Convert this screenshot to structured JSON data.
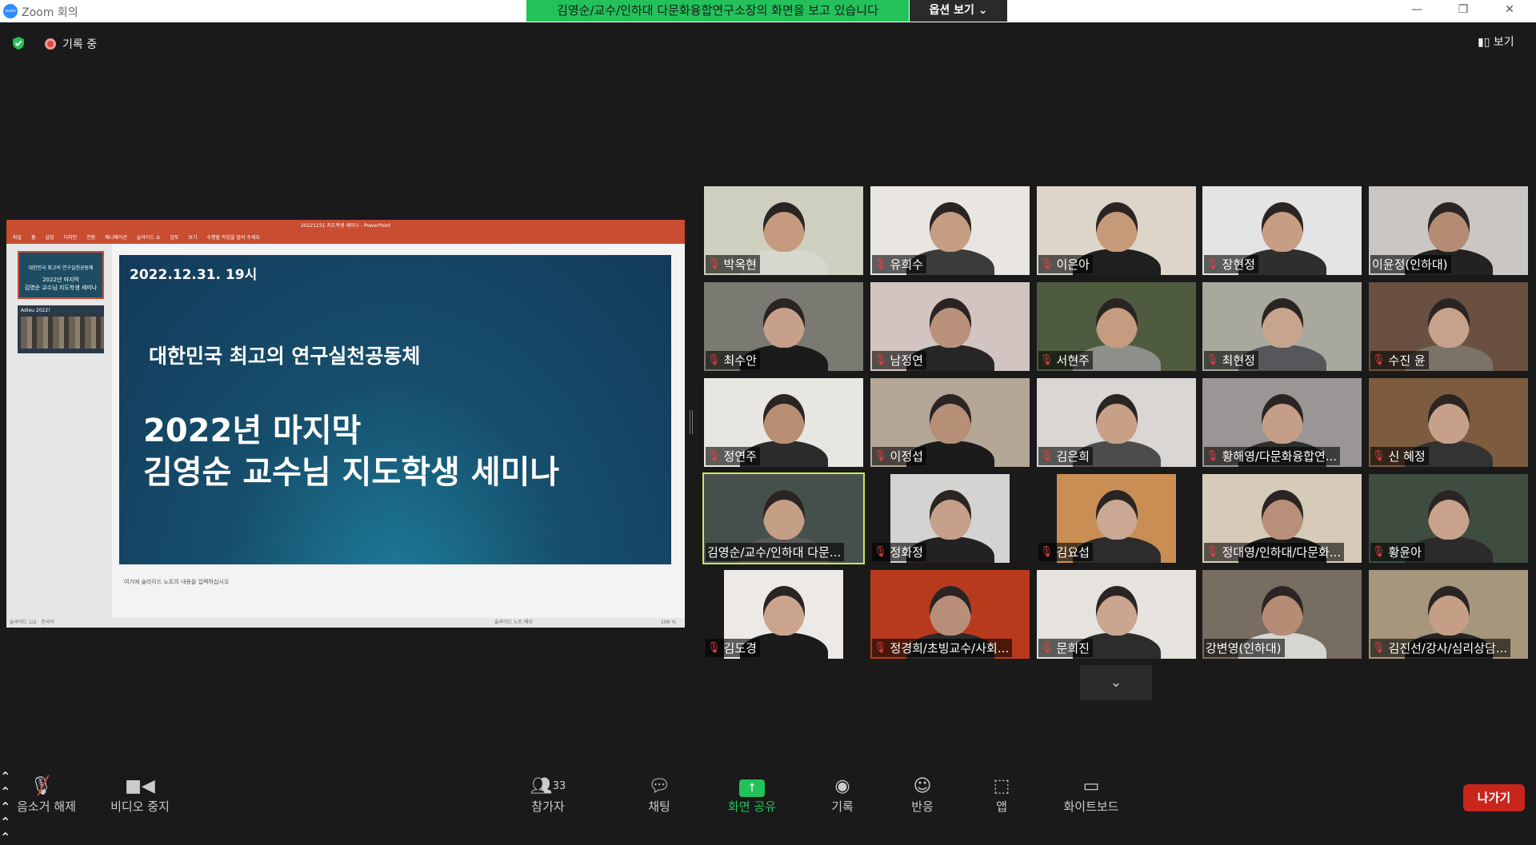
{
  "window": {
    "title": "Zoom 회의",
    "logo_text": "zoom"
  },
  "share_banner": "김영순/교수/인하대 다문화융합연구소장의 화면을 보고 있습니다",
  "view_options": "옵션 보기",
  "recording_label": "기록 중",
  "view_button": "보기",
  "powerpoint": {
    "title": "20221231 지도학생 세미나 - PowerPoint",
    "ribbon_tabs": [
      "파일",
      "홈",
      "삽입",
      "디자인",
      "전환",
      "애니메이션",
      "슬라이드 쇼",
      "검토",
      "보기",
      "수행할 작업을 알려 주세요"
    ],
    "thumb1_lines": [
      "대한민국 최고의 연구실천공동체",
      "2022년 마지막",
      "김영순 교수님 지도학생 세미나"
    ],
    "thumb2_text": "Adieu 2022!",
    "slide": {
      "date": "2022.12.31. 19시",
      "subtitle": "대한민국 최고의 연구실천공동체",
      "heading_line1": "2022년 마지막",
      "heading_line2": "김영순 교수님 지도학생 세미나"
    },
    "notes_placeholder": "여기에 슬라이드 노트의 내용을 입력하십시오",
    "status_left": "슬라이드 1/2",
    "status_lang": "한국어",
    "status_right": "슬라이드 노트   메모",
    "zoom": "109 %"
  },
  "participants": [
    {
      "name": "박옥현",
      "muted": true,
      "bg": "#cfd0bf",
      "skin": "#c59a7e",
      "shirt": "#d8d7cf"
    },
    {
      "name": "유희수",
      "muted": true,
      "bg": "#e9e6e2",
      "skin": "#c49d82",
      "shirt": "#3b3b3b"
    },
    {
      "name": "이은아",
      "muted": true,
      "bg": "#ddd5c9",
      "skin": "#c69a79",
      "shirt": "#1f1f1f"
    },
    {
      "name": "장현정",
      "muted": true,
      "bg": "#e4e4e4",
      "skin": "#c79d84",
      "shirt": "#2e2e2e"
    },
    {
      "name": "이윤정(인하대)",
      "muted": false,
      "bg": "#c9c6c3",
      "skin": "#b48c74",
      "shirt": "#222"
    },
    {
      "name": "최수안",
      "muted": true,
      "bg": "#7a7a72",
      "skin": "#c6a08a",
      "shirt": "#1b1b1b"
    },
    {
      "name": "남정연",
      "muted": true,
      "bg": "#d2c4c0",
      "skin": "#ba917a",
      "shirt": "#262626"
    },
    {
      "name": "서현주",
      "muted": true,
      "bg": "#4f5b3f",
      "skin": "#c59c80",
      "shirt": "#8d8f8a"
    },
    {
      "name": "최현정",
      "muted": true,
      "bg": "#a8a89f",
      "skin": "#c7a48c",
      "shirt": "#55575a"
    },
    {
      "name": "수진 윤",
      "muted": true,
      "bg": "#6a5040",
      "skin": "#c7a28b",
      "shirt": "#7b7268"
    },
    {
      "name": "정연주",
      "muted": true,
      "bg": "#e8e6e1",
      "skin": "#b98f73",
      "shirt": "#2b2b2b"
    },
    {
      "name": "이정섭",
      "muted": true,
      "bg": "#b4a798",
      "skin": "#b58f76",
      "shirt": "#1b1b1b"
    },
    {
      "name": "김은희",
      "muted": true,
      "bg": "#d9d6d3",
      "skin": "#c8a088",
      "shirt": "#4c4c4c"
    },
    {
      "name": "황해영/다문화융합연...",
      "muted": true,
      "bg": "#9a9695",
      "skin": "#c49e88",
      "shirt": "#2e2e2e"
    },
    {
      "name": "신 혜정",
      "muted": true,
      "bg": "#7d5b3e",
      "skin": "#c7a08a",
      "shirt": "#333"
    },
    {
      "name": "김영순/교수/인하대 다문...",
      "muted": false,
      "bg": "#45504c",
      "skin": "#c49f86",
      "shirt": "#5a5a58",
      "active": true
    },
    {
      "name": "정화정",
      "muted": true,
      "bg": "#d4d3d2",
      "skin": "#c6a08a",
      "shirt": "#222",
      "narrow": true
    },
    {
      "name": "김요섭",
      "muted": true,
      "bg": "#c98e54",
      "skin": "#caa894",
      "shirt": "#2c2c2c",
      "narrow": true
    },
    {
      "name": "정대영/인하대/다문화...",
      "muted": true,
      "bg": "#d6cbb8",
      "skin": "#b89079",
      "shirt": "#1e1e1e"
    },
    {
      "name": "황윤아",
      "muted": true,
      "bg": "#3f4c40",
      "skin": "#c8a28a",
      "shirt": "#2b2b2b"
    },
    {
      "name": "김도경",
      "muted": true,
      "bg": "#ece9e6",
      "skin": "#caa48c",
      "shirt": "#1b1b1b",
      "narrow": true
    },
    {
      "name": "정경희/초빙교수/사회...",
      "muted": true,
      "bg": "#b83a1c",
      "skin": "#b98e78",
      "shirt": "#2a2a2a"
    },
    {
      "name": "문희진",
      "muted": true,
      "bg": "#e6e3df",
      "skin": "#caa590",
      "shirt": "#2c2c2c"
    },
    {
      "name": "강변영(인하대)",
      "muted": false,
      "bg": "#776d60",
      "skin": "#b58c74",
      "shirt": "#d6d5d1"
    },
    {
      "name": "김진선/강사/심리상담...",
      "muted": true,
      "bg": "#a5967c",
      "skin": "#c59e86",
      "shirt": "#242424"
    }
  ],
  "toolbar": {
    "unmute": "음소거 해제",
    "stop_video": "비디오 중지",
    "participants": "참가자",
    "participant_count": "33",
    "chat": "채팅",
    "share_screen": "화면 공유",
    "record": "기록",
    "reactions": "반응",
    "apps": "앱",
    "whiteboard": "화이트보드",
    "leave": "나가기"
  },
  "colors": {
    "share_green": "#23c15a",
    "leave_red": "#c8251d",
    "active_speaker": "#c8e85a",
    "ppt_accent": "#c84d31"
  }
}
